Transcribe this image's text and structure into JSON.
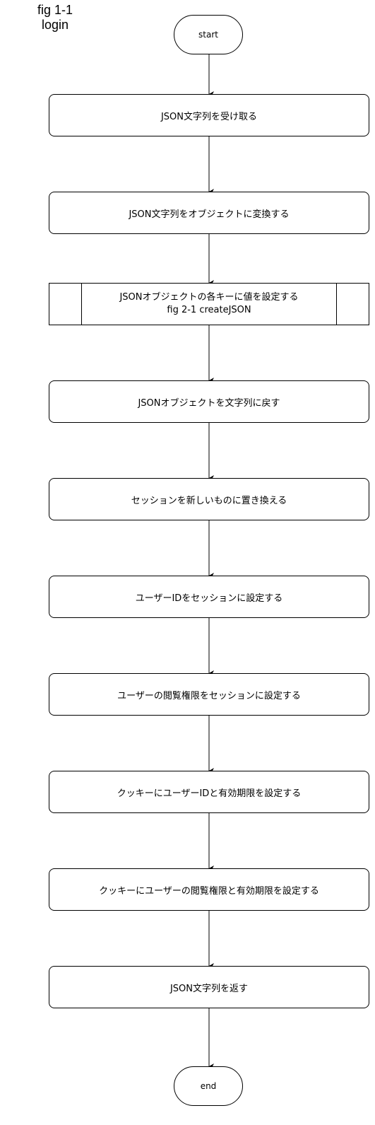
{
  "figure": {
    "label_line1": "fig 1-1",
    "label_line2": "login"
  },
  "start_label": "start",
  "end_label": "end",
  "steps": [
    {
      "text": "JSON文字列を受け取る"
    },
    {
      "text": "JSON文字列をオブジェクトに変換する"
    },
    {
      "text": "JSONオブジェクトの各キーに値を設定する",
      "subtext": "fig 2-1 createJSON",
      "kind": "subprocess"
    },
    {
      "text": "JSONオブジェクトを文字列に戻す"
    },
    {
      "text": "セッションを新しいものに置き換える"
    },
    {
      "text": "ユーザーIDをセッションに設定する"
    },
    {
      "text": "ユーザーの閲覧権限をセッションに設定する"
    },
    {
      "text": "クッキーにユーザーIDと有効期限を設定する"
    },
    {
      "text": "クッキーにユーザーの閲覧権限と有効期限を設定する"
    },
    {
      "text": "JSON文字列を返す"
    }
  ],
  "colors": {
    "stroke": "#000000",
    "fill": "#ffffff"
  }
}
